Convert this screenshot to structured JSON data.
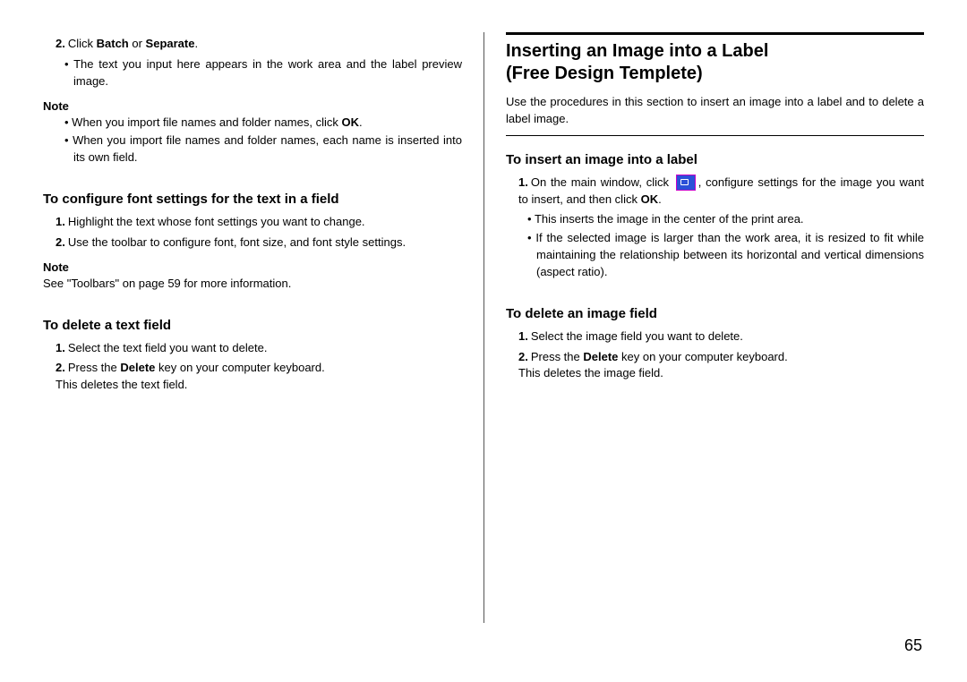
{
  "left": {
    "step2_num": "2.",
    "step2_pre": "Click ",
    "step2_b1": "Batch",
    "step2_mid": " or ",
    "step2_b2": "Separate",
    "step2_post": ".",
    "step2_bullet": "The text you input here appears in the work area and the label preview image.",
    "note1_hd": "Note",
    "note1_b1_pre": "When you import file names and folder names, click ",
    "note1_b1_bold": "OK",
    "note1_b1_post": ".",
    "note1_b2": "When you import file names and folder names, each name is inserted into its own field.",
    "configure_hd": "To configure font settings for the text in a field",
    "cfg_s1_num": "1.",
    "cfg_s1": "Highlight the text whose font settings you want to change.",
    "cfg_s2_num": "2.",
    "cfg_s2": "Use the toolbar to configure font, font size, and font style settings.",
    "note2_hd": "Note",
    "note2_body": "See \"Toolbars\" on page 59 for more information.",
    "delete_hd": "To delete a text field",
    "del_s1_num": "1.",
    "del_s1": "Select the text field you want to delete.",
    "del_s2_num": "2.",
    "del_s2_pre": "Press the ",
    "del_s2_bold": "Delete",
    "del_s2_post": " key on your computer keyboard.",
    "del_s2_line2": "This deletes the text field."
  },
  "right": {
    "title_l1": "Inserting an Image into a Label",
    "title_l2": "(Free Design Templete)",
    "intro": "Use the procedures in this section to insert an image into a label and to delete a label image.",
    "insert_hd": "To insert an image into a label",
    "ins_s1_num": "1.",
    "ins_s1_pre": "On the main window, click ",
    "ins_s1_mid": ", configure settings for the image you want to insert, and then click ",
    "ins_s1_bold": "OK",
    "ins_s1_post": ".",
    "ins_b1": "This inserts the image in the center of the print area.",
    "ins_b2": "If the selected image is larger than the work area, it is resized to fit while maintaining the relationship between its horizontal and vertical dimensions (aspect ratio).",
    "del_img_hd": "To delete an image field",
    "di_s1_num": "1.",
    "di_s1": "Select the image field you want to delete.",
    "di_s2_num": "2.",
    "di_s2_pre": "Press the ",
    "di_s2_bold": "Delete",
    "di_s2_post": " key on your computer keyboard.",
    "di_s2_line2": "This deletes the image field."
  },
  "page_number": "65"
}
